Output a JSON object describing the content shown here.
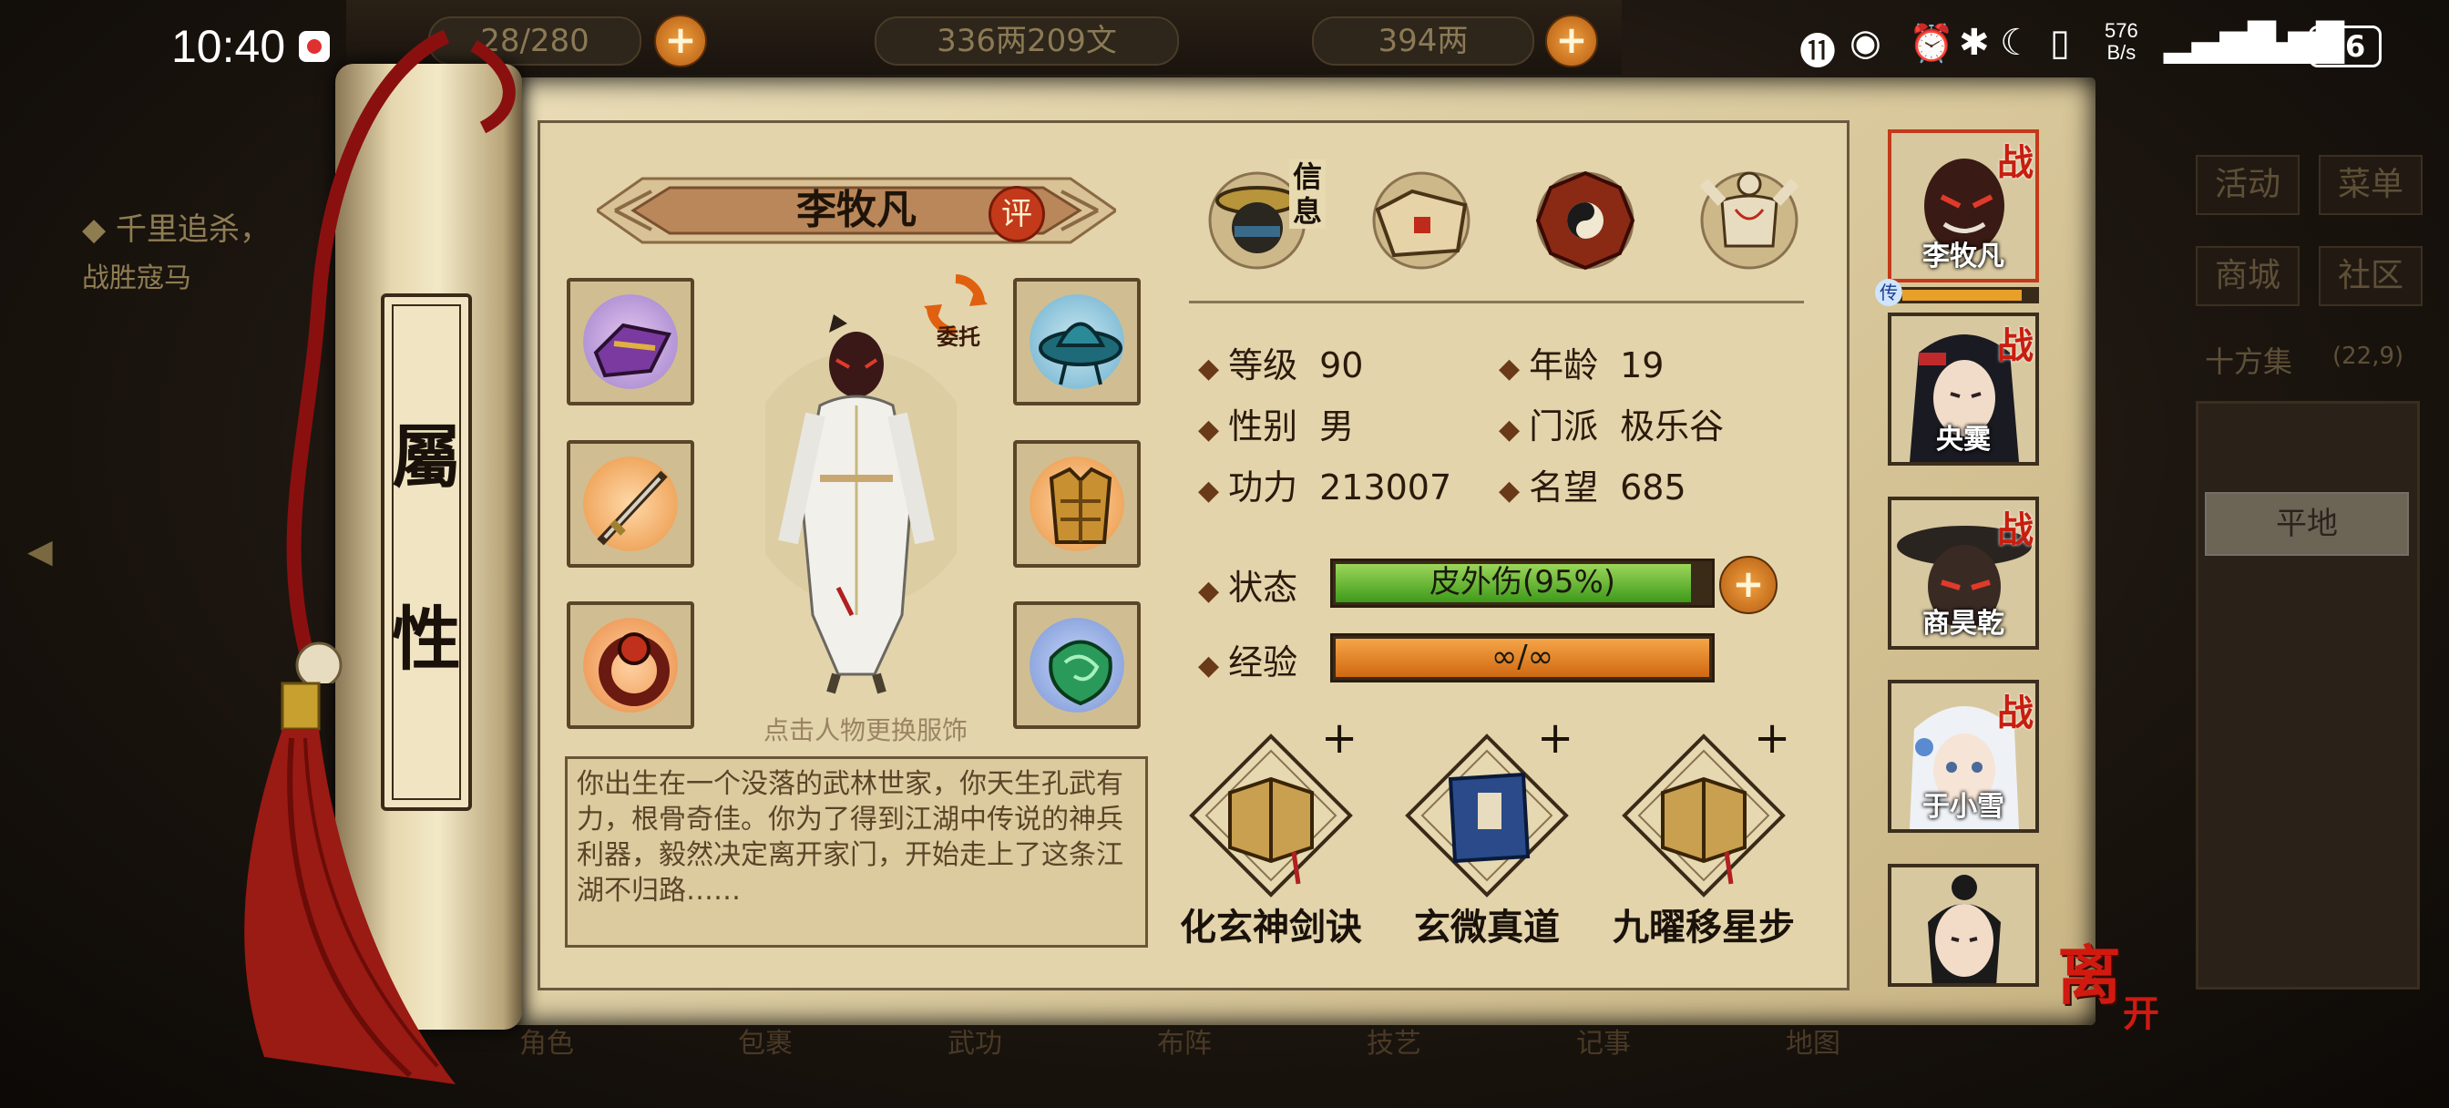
{
  "status_bar": {
    "time": "10:40",
    "net_speed_value": "576",
    "net_speed_unit": "B/s",
    "battery": "36"
  },
  "top_resources": {
    "stamina": "28/280",
    "copper": "336两209文",
    "gold": "394两"
  },
  "quest": {
    "title": "◆ 千里追杀，",
    "subtitle": "战胜寇马"
  },
  "side_menu": {
    "items": [
      "活动",
      "菜单",
      "商城",
      "社区"
    ],
    "location": "十方集",
    "coords": "(22,9)",
    "terrain": "平地"
  },
  "bottom_nav": [
    "角色",
    "包裹",
    "武功",
    "布阵",
    "技艺",
    "记事",
    "地图"
  ],
  "scroll": {
    "title_top": "屬",
    "title_bottom": "性"
  },
  "character": {
    "name": "李牧凡",
    "rate_badge": "评",
    "delegate_label": "委托",
    "outfit_hint": "点击人物更换服饰",
    "bio": "你出生在一个没落的武林世家，你天生孔武有力，根骨奇佳。你为了得到江湖中传说的神兵利器，毅然决定离开家门，开始走上了这条江湖不归路……"
  },
  "tabs": {
    "info_label": "信息"
  },
  "stats": {
    "level_label": "等级",
    "level": "90",
    "age_label": "年龄",
    "age": "19",
    "gender_label": "性别",
    "gender": "男",
    "sect_label": "门派",
    "sect": "极乐谷",
    "power_label": "功力",
    "power": "213007",
    "fame_label": "名望",
    "fame": "685",
    "status_label": "状态",
    "status_value": "皮外伤(95%)",
    "status_percent": 95,
    "exp_label": "经验",
    "exp_value": "∞/∞",
    "exp_percent": 100
  },
  "skills": [
    {
      "name": "化玄神剑诀",
      "plus": "+"
    },
    {
      "name": "玄微真道",
      "plus": "+"
    },
    {
      "name": "九曜移星步",
      "plus": "+"
    }
  ],
  "roster": [
    {
      "name": "李牧凡",
      "battle": "战",
      "active": true
    },
    {
      "name": "央霙",
      "battle": "战",
      "active": false
    },
    {
      "name": "商昊乾",
      "battle": "战",
      "active": false
    },
    {
      "name": "于小雪",
      "battle": "战",
      "active": false
    },
    {
      "name": "",
      "battle": "",
      "active": false
    }
  ],
  "roster_hp_icon": "传",
  "roster_hp_fraction": 0.9,
  "leave_button": {
    "char1": "离",
    "char2": "开"
  },
  "colors": {
    "panel": "#e3d4ab",
    "status_green": "#3e9a1a",
    "exp_orange": "#d06812",
    "accent_red": "#c23a1a"
  }
}
